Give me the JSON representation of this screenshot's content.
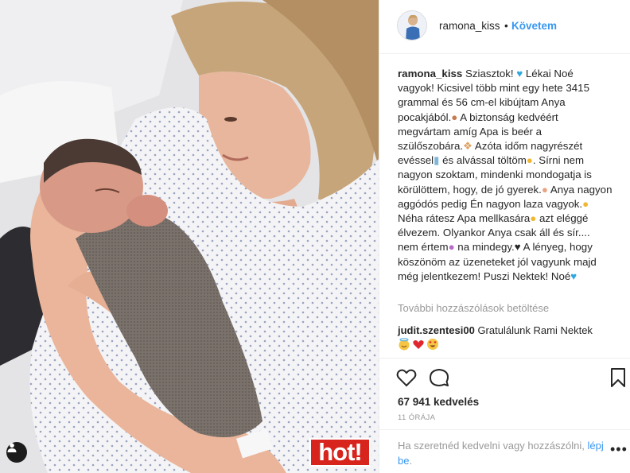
{
  "header": {
    "username": "ramona_kiss",
    "dot": "•",
    "follow_label": "Követem"
  },
  "caption": {
    "username": "ramona_kiss",
    "parts": [
      "Sziasztok! ",
      " Lékai Noé vagyok!",
      " Kicsivel több mint egy hete 3415 grammal és 56 cm-el kibújtam Anya pocakjából.",
      " A biztonság kedvéért megvártam amíg Apa is beér a szülőszobára.",
      " Azóta időm nagyrészét evéssel",
      " és alvással töltöm",
      ". Sírni nem nagyon szoktam, mindenki mondogatja is körülöttem, hogy, de jó gyerek.",
      " Anya nagyon aggódós pedig Én nagyon laza vagyok.",
      " Néha rátesz Apa mellkasára",
      " azt eléggé élvezem. Olyankor Anya csak áll és sír.... nem értem",
      " na mindegy.♥ A lényeg, hogy köszönöm az üzeneteket jól vagyunk majd még jelentkezem! Puszi Nektek! Noé"
    ]
  },
  "load_more": "További hozzászólások betöltése",
  "comment": {
    "username": "judit.szentesi00",
    "text": "Gratulálunk Rami Nektek"
  },
  "likes": "67 941 kedvelés",
  "time": "11 ÓRÁJA",
  "login": {
    "text": "Ha szeretnéd kedvelni vagy hozzászólni,",
    "link": "lépj be",
    "after": "."
  },
  "more_dots": "•••",
  "watermark": "hot!",
  "icons": {
    "like": "heart-outline-icon",
    "comment": "comment-bubble-icon",
    "save": "bookmark-icon",
    "user_tag": "user-tag-icon"
  },
  "colors": {
    "link": "#3897f0",
    "muted": "#999999",
    "text": "#262626",
    "watermark_red": "#d7241c"
  }
}
